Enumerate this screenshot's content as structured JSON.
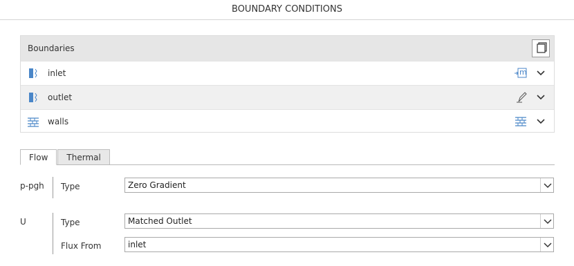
{
  "panel": {
    "title": "BOUNDARY CONDITIONS"
  },
  "boundaries": {
    "header": "Boundaries",
    "items": [
      {
        "label": "inlet",
        "icon": "patch-icon",
        "action": "mapped-icon",
        "actionText": "m"
      },
      {
        "label": "outlet",
        "icon": "patch-icon",
        "action": "edit-pencil-icon"
      },
      {
        "label": "walls",
        "icon": "wall-icon",
        "action": "wall-icon"
      }
    ]
  },
  "tabs": [
    {
      "label": "Flow",
      "active": true
    },
    {
      "label": "Thermal",
      "active": false
    }
  ],
  "groups": [
    {
      "label": "p-pgh",
      "fields": [
        {
          "label": "Type",
          "value": "Zero Gradient"
        }
      ]
    },
    {
      "label": "U",
      "fields": [
        {
          "label": "Type",
          "value": "Matched Outlet"
        },
        {
          "label": "Flux From",
          "value": "inlet"
        }
      ]
    }
  ],
  "colors": {
    "accent": "#4a86c8",
    "headerBg": "#e6e6e6",
    "altRow": "#f0f0f0"
  }
}
